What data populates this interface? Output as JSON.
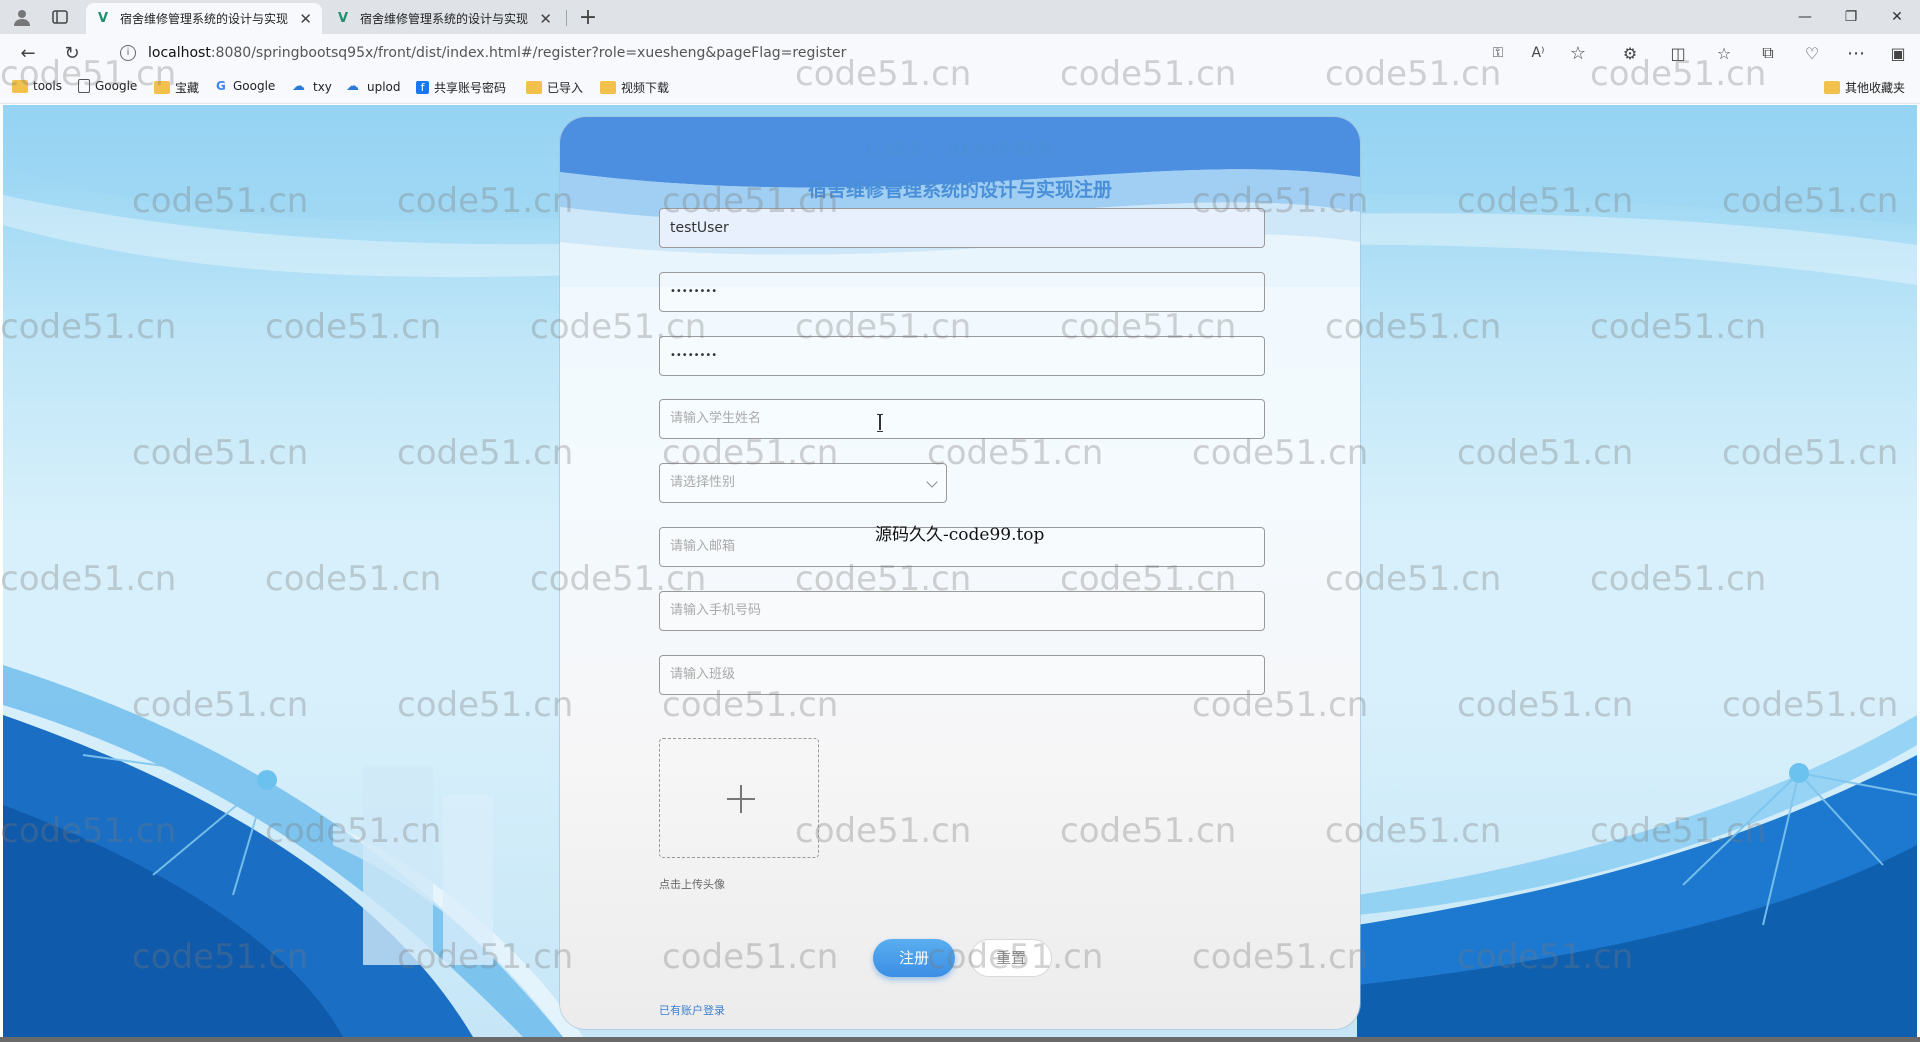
{
  "browser": {
    "tabs": [
      {
        "title": "宿舍维修管理系统的设计与实现",
        "active": true
      },
      {
        "title": "宿舍维修管理系统的设计与实现",
        "active": false
      }
    ],
    "url_host": "localhost",
    "url_rest": ":8080/springbootsq95x/front/dist/index.html#/register?role=xuesheng&pageFlag=register",
    "bookmarks": [
      {
        "label": "tools",
        "icon": "folder-icon"
      },
      {
        "label": "Google",
        "icon": "page-icon"
      },
      {
        "label": "宝藏",
        "icon": "folder-icon"
      },
      {
        "label": "Google",
        "icon": "google-icon"
      },
      {
        "label": "txy",
        "icon": "cloud-icon"
      },
      {
        "label": "uplod",
        "icon": "cloud-icon"
      },
      {
        "label": "共享账号密码",
        "icon": "facebook-icon"
      },
      {
        "label": "已导入",
        "icon": "folder-icon"
      },
      {
        "label": "视频下载",
        "icon": "folder-icon"
      }
    ],
    "other_bookmarks": "其他收藏夹"
  },
  "register": {
    "title": "USER / REGISTER",
    "subtitle": "宿舍维修管理系统的设计与实现注册",
    "account_value": "testUser",
    "password_value": "••••••••",
    "confirm_password_value": "••••••••",
    "name_placeholder": "请输入学生姓名",
    "gender_placeholder": "请选择性别",
    "email_placeholder": "请输入邮箱",
    "phone_placeholder": "请输入手机号码",
    "class_placeholder": "请输入班级",
    "upload_hint": "点击上传头像",
    "register_button": "注册",
    "reset_button": "重置",
    "login_link": "已有账户登录"
  },
  "overlay_caption": "源码久久-code99.top",
  "watermark_text": "code51.cn",
  "colors": {
    "accent": "#4a8fd9",
    "button_blue": "#3b8ee4",
    "background_sky": "#bfe6f8"
  }
}
